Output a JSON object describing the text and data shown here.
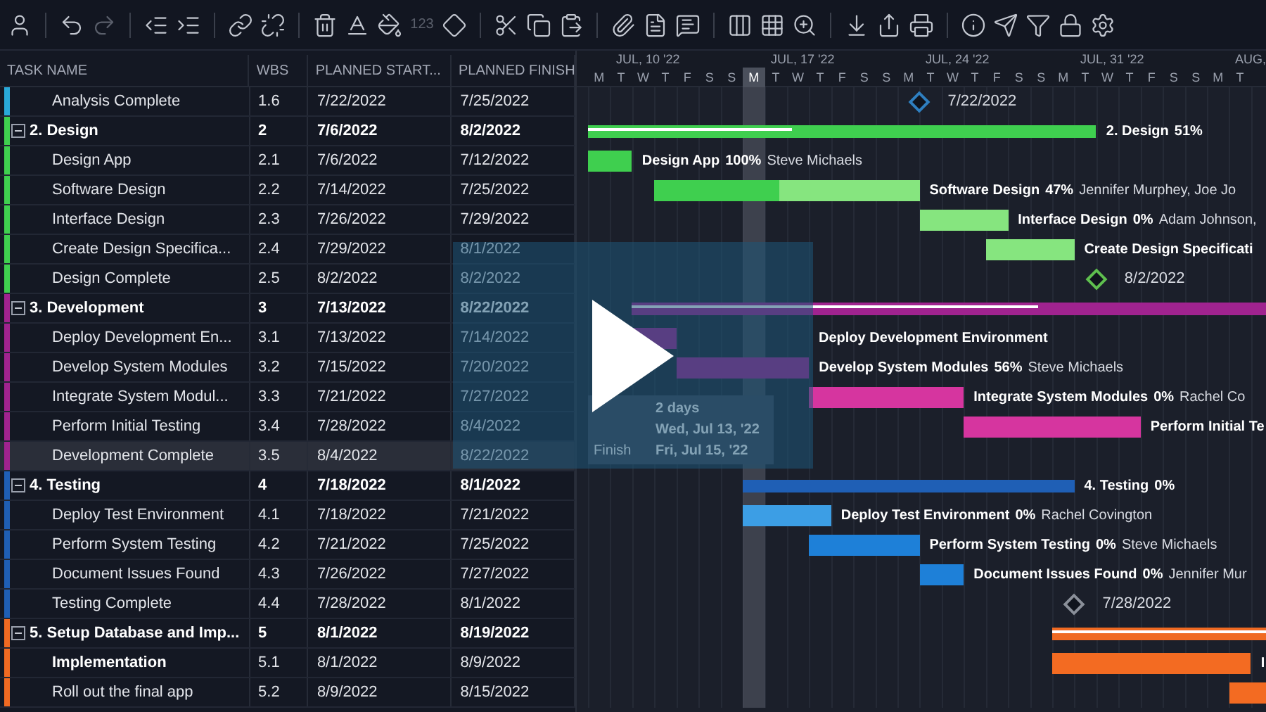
{
  "toolbar": {
    "groups": [
      [
        {
          "disabled": false
        }
      ],
      [
        {
          "disabled": false
        },
        {
          "disabled": true
        }
      ],
      [
        {
          "disabled": false
        },
        {
          "disabled": false
        }
      ],
      [
        {
          "disabled": false
        },
        {
          "disabled": false
        }
      ],
      [
        {
          "disabled": false
        },
        {
          "disabled": false
        },
        {
          "disabled": false
        },
        {
          "label": "123",
          "disabled": true
        },
        {
          "disabled": false
        }
      ],
      [
        {
          "disabled": false
        },
        {
          "disabled": false
        },
        {
          "disabled": false
        }
      ],
      [
        {
          "disabled": false
        },
        {
          "disabled": false
        },
        {
          "disabled": false
        }
      ],
      [
        {
          "disabled": false
        },
        {
          "disabled": false
        },
        {
          "disabled": false
        }
      ],
      [
        {
          "disabled": false
        },
        {
          "disabled": false
        },
        {
          "disabled": false
        }
      ],
      [
        {
          "disabled": false
        },
        {
          "disabled": false
        },
        {
          "disabled": false
        },
        {
          "disabled": false
        },
        {
          "disabled": false
        }
      ]
    ]
  },
  "table": {
    "columns": [
      "TASK NAME",
      "WBS",
      "PLANNED START...",
      "PLANNED FINISH"
    ],
    "rows": [
      {
        "kind": "task",
        "task": "Analysis Complete",
        "wbs": "1.6",
        "start": "7/22/2022",
        "finish": "7/25/2022",
        "color": "#29a9d9",
        "selected": false
      },
      {
        "kind": "group",
        "task": "2. Design",
        "wbs": "2",
        "start": "7/6/2022",
        "finish": "8/2/2022",
        "color": "#3fcf4f",
        "expanded": true,
        "selected": false
      },
      {
        "kind": "task",
        "task": "Design App",
        "wbs": "2.1",
        "start": "7/6/2022",
        "finish": "7/12/2022",
        "color": "#3fcf4f",
        "selected": false
      },
      {
        "kind": "task",
        "task": "Software Design",
        "wbs": "2.2",
        "start": "7/14/2022",
        "finish": "7/25/2022",
        "color": "#3fcf4f",
        "selected": false
      },
      {
        "kind": "task",
        "task": "Interface Design",
        "wbs": "2.3",
        "start": "7/26/2022",
        "finish": "7/29/2022",
        "color": "#3fcf4f",
        "selected": false
      },
      {
        "kind": "task",
        "task": "Create Design Specifica...",
        "wbs": "2.4",
        "start": "7/29/2022",
        "finish": "8/1/2022",
        "color": "#3fcf4f",
        "selected": false
      },
      {
        "kind": "task",
        "task": "Design Complete",
        "wbs": "2.5",
        "start": "8/2/2022",
        "finish": "8/2/2022",
        "color": "#3fcf4f",
        "selected": false
      },
      {
        "kind": "group",
        "task": "3. Development",
        "wbs": "3",
        "start": "7/13/2022",
        "finish": "8/22/2022",
        "color": "#a0238f",
        "expanded": true,
        "selected": false
      },
      {
        "kind": "task",
        "task": "Deploy Development En...",
        "wbs": "3.1",
        "start": "7/13/2022",
        "finish": "7/14/2022",
        "color": "#a0238f",
        "selected": false
      },
      {
        "kind": "task",
        "task": "Develop System Modules",
        "wbs": "3.2",
        "start": "7/15/2022",
        "finish": "7/20/2022",
        "color": "#a0238f",
        "selected": false
      },
      {
        "kind": "task",
        "task": "Integrate System Modul...",
        "wbs": "3.3",
        "start": "7/21/2022",
        "finish": "7/27/2022",
        "color": "#a0238f",
        "selected": false
      },
      {
        "kind": "task",
        "task": "Perform Initial Testing",
        "wbs": "3.4",
        "start": "7/28/2022",
        "finish": "8/4/2022",
        "color": "#a0238f",
        "selected": false
      },
      {
        "kind": "task",
        "task": "Development Complete",
        "wbs": "3.5",
        "start": "8/4/2022",
        "finish": "8/22/2022",
        "color": "#a0238f",
        "selected": true
      },
      {
        "kind": "group",
        "task": "4. Testing",
        "wbs": "4",
        "start": "7/18/2022",
        "finish": "8/1/2022",
        "color": "#1f5fb5",
        "expanded": true,
        "selected": false
      },
      {
        "kind": "task",
        "task": "Deploy Test Environment",
        "wbs": "4.1",
        "start": "7/18/2022",
        "finish": "7/21/2022",
        "color": "#1f5fb5",
        "selected": false
      },
      {
        "kind": "task",
        "task": "Perform System Testing",
        "wbs": "4.2",
        "start": "7/21/2022",
        "finish": "7/25/2022",
        "color": "#1f5fb5",
        "selected": false
      },
      {
        "kind": "task",
        "task": "Document Issues Found",
        "wbs": "4.3",
        "start": "7/26/2022",
        "finish": "7/27/2022",
        "color": "#1f5fb5",
        "selected": false
      },
      {
        "kind": "task",
        "task": "Testing Complete",
        "wbs": "4.4",
        "start": "7/28/2022",
        "finish": "8/1/2022",
        "color": "#1f5fb5",
        "selected": false
      },
      {
        "kind": "group",
        "task": "5. Setup Database and Imp...",
        "wbs": "5",
        "start": "8/1/2022",
        "finish": "8/19/2022",
        "color": "#f06a22",
        "expanded": true,
        "selected": false
      },
      {
        "kind": "subgroup",
        "task": "Implementation",
        "wbs": "5.1",
        "start": "8/1/2022",
        "finish": "8/9/2022",
        "color": "#f06a22",
        "selected": false
      },
      {
        "kind": "task",
        "task": "Roll out the final app",
        "wbs": "5.2",
        "start": "8/9/2022",
        "finish": "8/15/2022",
        "color": "#f06a22",
        "selected": false
      }
    ]
  },
  "gantt": {
    "weeks": [
      {
        "label": "JUL, 10 '22",
        "days": [
          {
            "letter": "M",
            "today": false
          },
          {
            "letter": "T",
            "today": false
          },
          {
            "letter": "W",
            "today": false
          },
          {
            "letter": "T",
            "today": false
          },
          {
            "letter": "F",
            "today": false
          },
          {
            "letter": "S",
            "today": false
          },
          {
            "letter": "S",
            "today": false
          }
        ]
      },
      {
        "label": "JUL, 17 '22",
        "days": [
          {
            "letter": "M",
            "today": true
          },
          {
            "letter": "T",
            "today": false
          },
          {
            "letter": "W",
            "today": false
          },
          {
            "letter": "T",
            "today": false
          },
          {
            "letter": "F",
            "today": false
          },
          {
            "letter": "S",
            "today": false
          },
          {
            "letter": "S",
            "today": false
          }
        ]
      },
      {
        "label": "JUL, 24 '22",
        "days": [
          {
            "letter": "M",
            "today": false
          },
          {
            "letter": "T",
            "today": false
          },
          {
            "letter": "W",
            "today": false
          },
          {
            "letter": "T",
            "today": false
          },
          {
            "letter": "F",
            "today": false
          },
          {
            "letter": "S",
            "today": false
          },
          {
            "letter": "S",
            "today": false
          }
        ]
      },
      {
        "label": "JUL, 31 '22",
        "days": [
          {
            "letter": "M",
            "today": false
          },
          {
            "letter": "T",
            "today": false
          },
          {
            "letter": "W",
            "today": false
          },
          {
            "letter": "T",
            "today": false
          },
          {
            "letter": "F",
            "today": false
          },
          {
            "letter": "S",
            "today": false
          },
          {
            "letter": "S",
            "today": false
          }
        ]
      },
      {
        "label": "AUG,",
        "days": [
          {
            "letter": "M",
            "today": false
          },
          {
            "letter": "T",
            "today": false
          }
        ]
      }
    ],
    "rows": [
      {
        "kind": "milestone",
        "date": "7/22/2022",
        "color": "#2f7fc0"
      },
      {
        "kind": "summary",
        "label": "2. Design",
        "percent": "51%",
        "level": 0.4
      },
      {
        "kind": "bar",
        "label": "Design App",
        "percent": "100%",
        "assignee": "Steve Michaels",
        "level": 1
      },
      {
        "kind": "bar",
        "label": "Software Design",
        "percent": "47%",
        "assignee": "Jennifer Murphey, Joe Jo",
        "color": "#86e57f",
        "level": 0.47
      },
      {
        "kind": "bar",
        "label": "Interface Design",
        "percent": "0%",
        "assignee": "Adam Johnson,",
        "color": "#86e57f"
      },
      {
        "kind": "bar",
        "label": "Create Design Specificati",
        "color": "#86e57f"
      },
      {
        "kind": "milestone",
        "date": "8/2/2022",
        "color": "#5fbf4f"
      },
      {
        "kind": "summary",
        "level": 0.64
      },
      {
        "kind": "bar",
        "label": "Deploy Development Environment"
      },
      {
        "kind": "bar",
        "label": "Develop System Modules",
        "percent": "56%",
        "assignee": "Steve Michaels"
      },
      {
        "kind": "bar",
        "label": "Integrate System Modules",
        "percent": "0%",
        "assignee": "Rachel Co",
        "color": "#d6359f"
      },
      {
        "kind": "bar",
        "label": "Perform Initial Te",
        "color": "#d6359f"
      },
      {
        "kind": "none"
      },
      {
        "kind": "summary",
        "label": "4. Testing",
        "percent": "0%"
      },
      {
        "kind": "bar",
        "label": "Deploy Test Environment",
        "percent": "0%",
        "assignee": "Rachel Covington",
        "color": "#3c9ee5"
      },
      {
        "kind": "bar",
        "label": "Perform System Testing",
        "percent": "0%",
        "assignee": "Steve Michaels",
        "color": "#1e80d8"
      },
      {
        "kind": "bar",
        "label": "Document Issues Found",
        "percent": "0%",
        "assignee": "Jennifer Mur",
        "color": "#1e80d8"
      },
      {
        "kind": "milestone",
        "date": "7/28/2022",
        "color": "#8a8f99"
      },
      {
        "kind": "summary",
        "level": 1
      },
      {
        "kind": "bar",
        "label": "I",
        "color": "#f36b22"
      },
      {
        "kind": "bar",
        "color": "#f36b22"
      }
    ],
    "tooltip": {
      "lines": [
        {
          "value": "2 days"
        },
        {
          "value": "Wed, Jul 13, '22"
        },
        {
          "label": "Finish",
          "value": "Fri, Jul 15, '22"
        }
      ]
    }
  },
  "video": {
    "playing": false
  }
}
